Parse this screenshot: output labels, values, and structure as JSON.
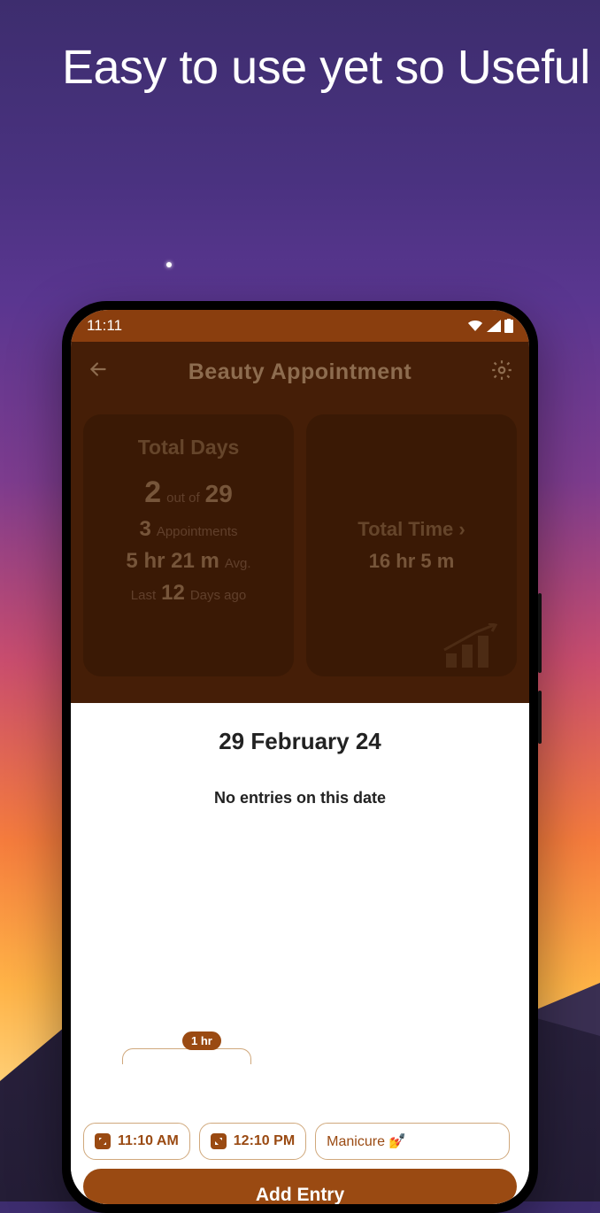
{
  "promo": {
    "headline": "Easy to use yet so Useful"
  },
  "statusbar": {
    "time": "11:11"
  },
  "header": {
    "title": "Beauty Appointment"
  },
  "stats": {
    "left": {
      "title": "Total Days",
      "days_count": "2",
      "out_of_label": "out of",
      "total_days": "29",
      "appointments_count": "3",
      "appointments_label": "Appointments",
      "avg_value": "5 hr 21 m",
      "avg_label": "Avg.",
      "last_label": "Last",
      "last_value": "12",
      "last_suffix": "Days ago"
    },
    "right": {
      "title": "Total Time ›",
      "value": "16 hr 5 m"
    }
  },
  "sheet": {
    "date": "29 February 24",
    "empty_message": "No entries on this date",
    "duration_badge": "1 hr",
    "start_time": "11:10 AM",
    "end_time": "12:10 PM",
    "tag": "Manicure 💅",
    "add_button": "Add Entry"
  }
}
